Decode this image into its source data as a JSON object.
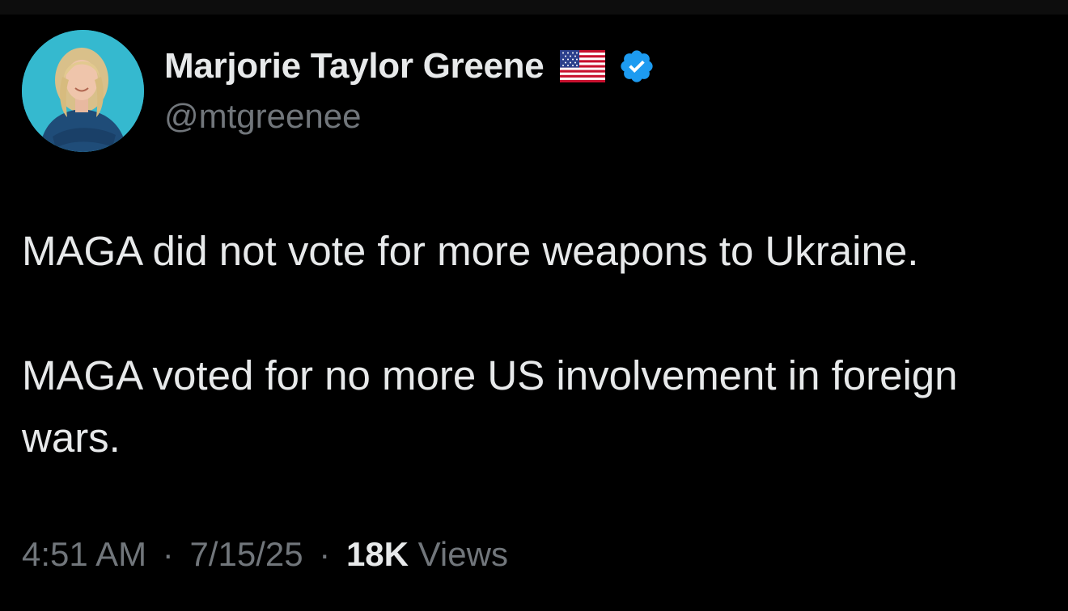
{
  "author": {
    "display_name": "Marjorie Taylor Greene",
    "handle": "@mtgreenee",
    "flag_icon": "us-flag-icon",
    "verified_icon": "verified-badge-icon",
    "verified_color": "#1d9bf0"
  },
  "tweet": {
    "paragraphs": [
      "MAGA did not vote for more weapons to Ukraine.",
      "MAGA voted for no more US involvement in foreign wars."
    ]
  },
  "meta": {
    "time": "4:51 AM",
    "separator": "·",
    "date": "7/15/25",
    "views_count": "18K",
    "views_label": "Views"
  },
  "colors": {
    "background": "#000000",
    "primary_text": "#e7e9ea",
    "secondary_text": "#71767b"
  }
}
